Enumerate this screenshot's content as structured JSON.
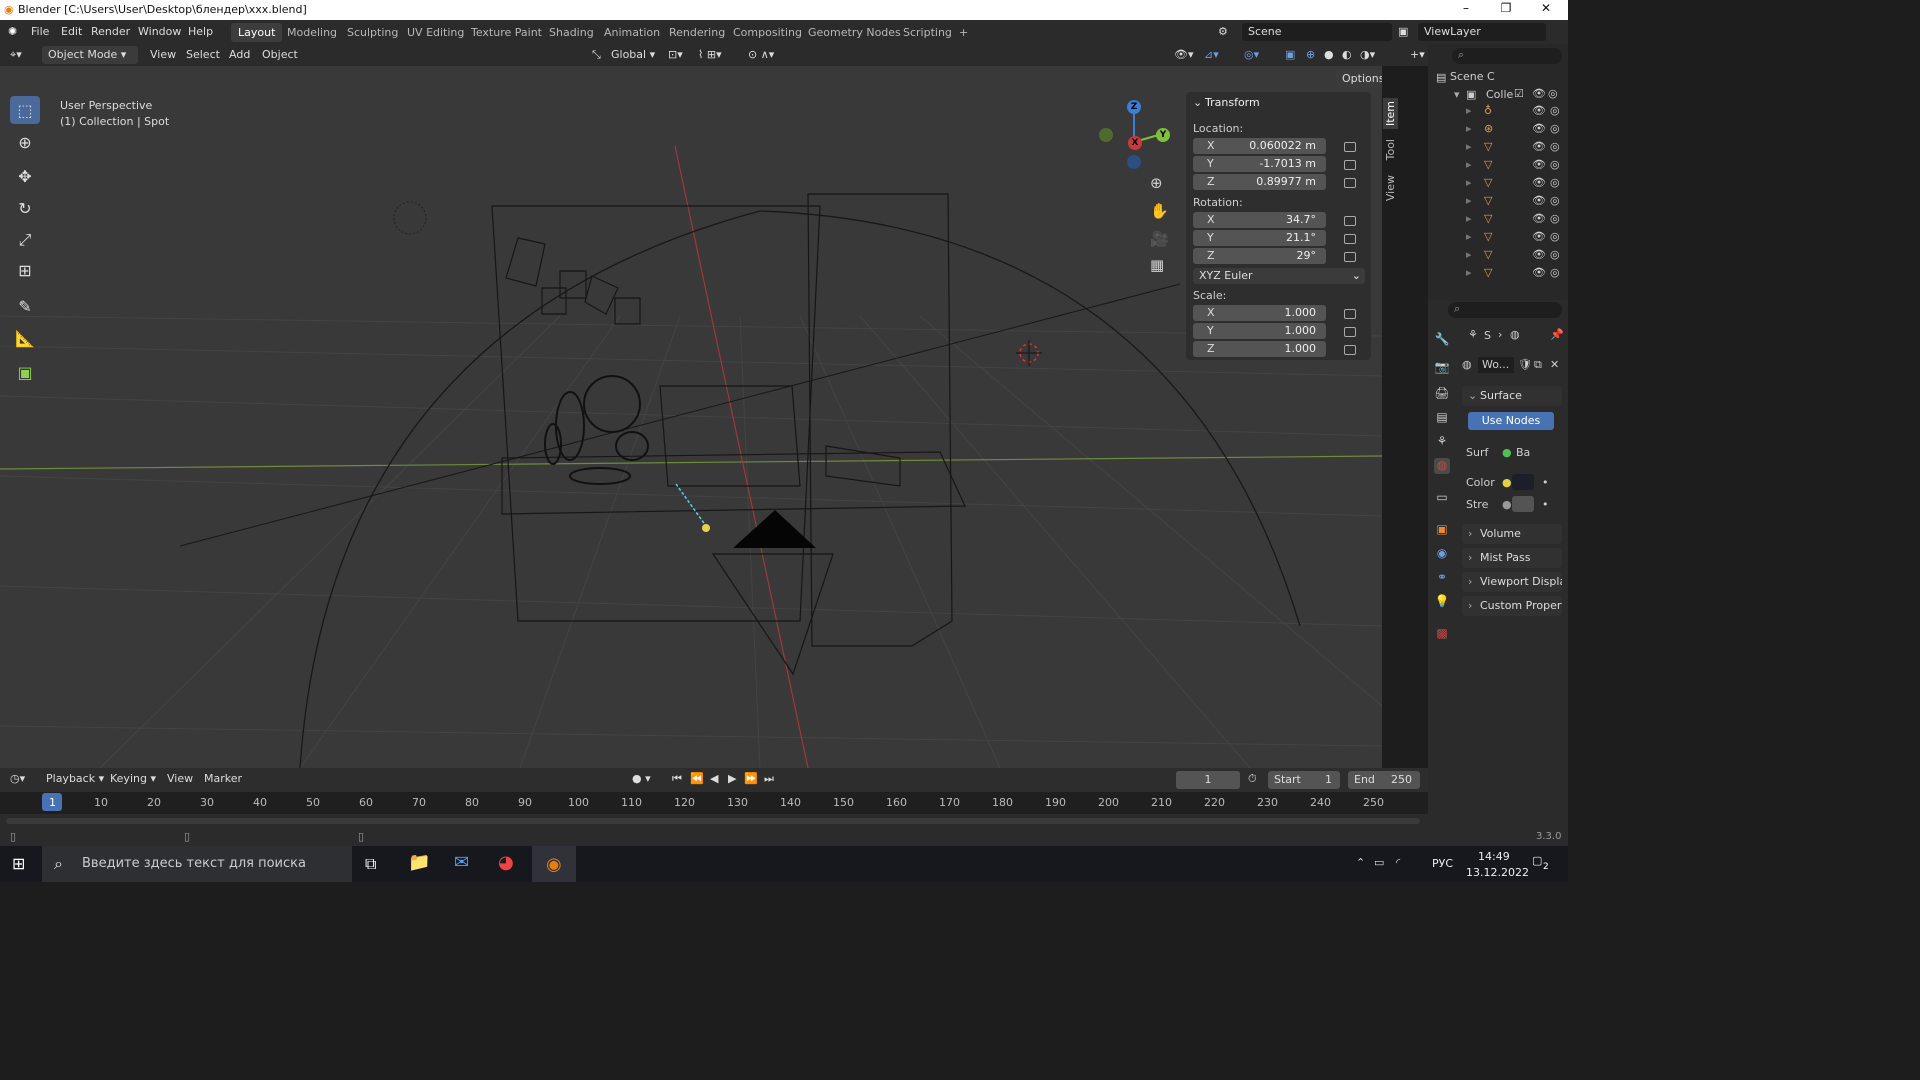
{
  "window": {
    "title": "Blender [C:\\Users\\User\\Desktop\\блендер\\xxx.blend]"
  },
  "menu": {
    "items": [
      "File",
      "Edit",
      "Render",
      "Window",
      "Help"
    ]
  },
  "workspaces": [
    "Layout",
    "Modeling",
    "Sculpting",
    "UV Editing",
    "Texture Paint",
    "Shading",
    "Animation",
    "Rendering",
    "Compositing",
    "Geometry Nodes",
    "Scripting",
    "+"
  ],
  "scene": {
    "name": "Scene",
    "view_layer": "ViewLayer"
  },
  "header": {
    "mode": "Object Mode",
    "menus": [
      "View",
      "Select",
      "Add",
      "Object"
    ],
    "transform_orientation": "Global",
    "options": "Options"
  },
  "viewport": {
    "perspective": "User Perspective",
    "collection": "(1) Collection | Spot"
  },
  "gizmo": {
    "x": "X",
    "y": "Y",
    "z": "Z"
  },
  "npanel": {
    "title": "Transform",
    "tabs": [
      "Item",
      "Tool",
      "View"
    ],
    "location_label": "Location:",
    "location": [
      {
        "axis": "X",
        "value": "0.060022 m"
      },
      {
        "axis": "Y",
        "value": "-1.7013 m"
      },
      {
        "axis": "Z",
        "value": "0.89977 m"
      }
    ],
    "rotation_label": "Rotation:",
    "rotation": [
      {
        "axis": "X",
        "value": "34.7°"
      },
      {
        "axis": "Y",
        "value": "21.1°"
      },
      {
        "axis": "Z",
        "value": "29°"
      }
    ],
    "rotation_mode": "XYZ Euler",
    "scale_label": "Scale:",
    "scale": [
      {
        "axis": "X",
        "value": "1.000"
      },
      {
        "axis": "Y",
        "value": "1.000"
      },
      {
        "axis": "Z",
        "value": "1.000"
      }
    ]
  },
  "outliner": {
    "scene": "Scene C",
    "collection": "Colle"
  },
  "properties": {
    "breadcrumb": "S",
    "world": "Wo...",
    "surface": "Surface",
    "use_nodes": "Use Nodes",
    "surf_label": "Surf",
    "surf_value": "Ba",
    "color_label": "Color",
    "strength_label": "Stre",
    "panels": [
      "Volume",
      "Mist Pass",
      "Viewport Display",
      "Custom Propertie"
    ]
  },
  "timeline": {
    "menus": [
      "Playback",
      "Keying",
      "View",
      "Marker"
    ],
    "current_frame": "1",
    "start_label": "Start",
    "start": "1",
    "end_label": "End",
    "end": "250",
    "ticks": [
      "1",
      "10",
      "20",
      "30",
      "40",
      "50",
      "60",
      "70",
      "80",
      "90",
      "100",
      "110",
      "120",
      "130",
      "140",
      "150",
      "160",
      "170",
      "180",
      "190",
      "200",
      "210",
      "220",
      "230",
      "240",
      "250"
    ]
  },
  "status": {
    "version": "3.3.0"
  },
  "taskbar": {
    "search_placeholder": "Введите здесь текст для поиска",
    "lang": "РУС",
    "time": "14:49",
    "date": "13.12.2022",
    "notification_count": "2"
  }
}
